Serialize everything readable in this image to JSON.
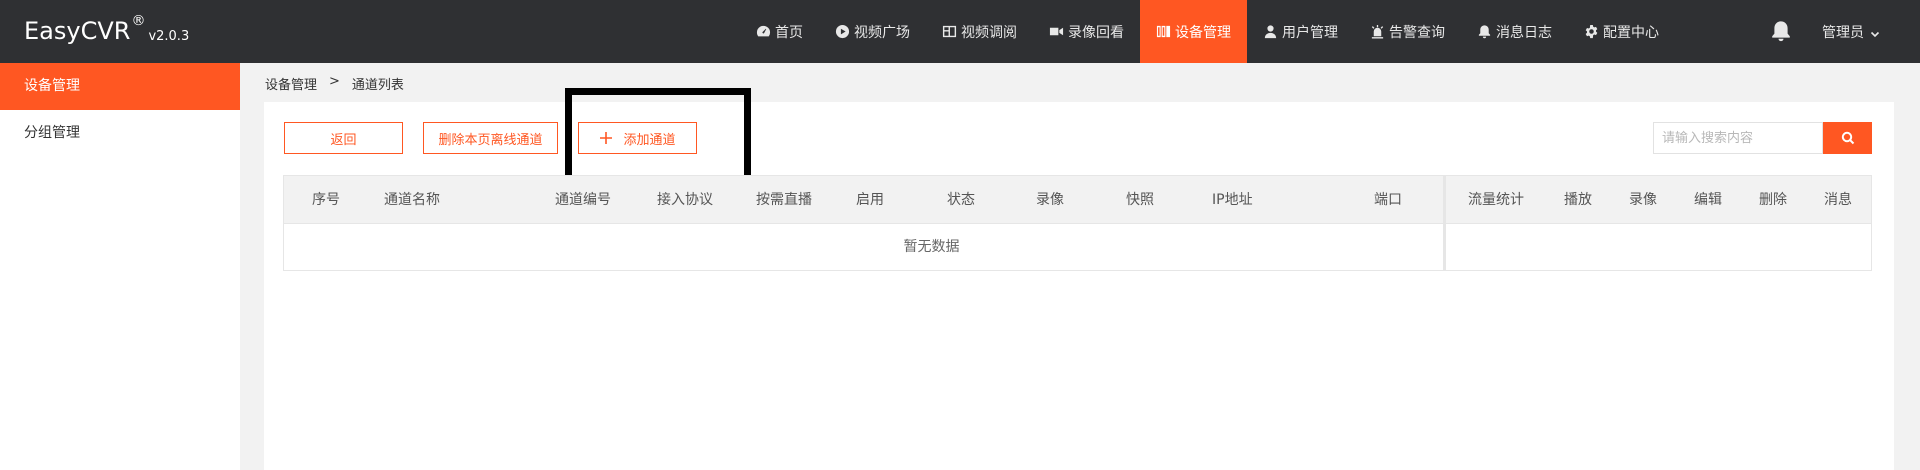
{
  "header": {
    "brand": "EasyCVR",
    "brand_reg": "®",
    "version": "v2.0.3",
    "nav": [
      {
        "label": "首页",
        "icon": "dashboard-icon",
        "active": false
      },
      {
        "label": "视频广场",
        "icon": "play-circle-icon",
        "active": false
      },
      {
        "label": "视频调阅",
        "icon": "grid-layout-icon",
        "active": false
      },
      {
        "label": "录像回看",
        "icon": "video-camera-icon",
        "active": false
      },
      {
        "label": "设备管理",
        "icon": "device-book-icon",
        "active": true
      },
      {
        "label": "用户管理",
        "icon": "user-icon",
        "active": false
      },
      {
        "label": "告警查询",
        "icon": "alarm-light-icon",
        "active": false
      },
      {
        "label": "消息日志",
        "icon": "bell-small-icon",
        "active": false
      },
      {
        "label": "配置中心",
        "icon": "gear-icon",
        "active": false
      }
    ],
    "user_label": "管理员"
  },
  "sidebar": {
    "items": [
      {
        "label": "设备管理",
        "active": true
      },
      {
        "label": "分组管理",
        "active": false
      }
    ]
  },
  "breadcrumb": {
    "parent": "设备管理",
    "separator": ">",
    "current": "通道列表"
  },
  "toolbar": {
    "back_label": "返回",
    "delete_offline_label": "删除本页离线通道",
    "add_channel_label": "添加通道"
  },
  "search": {
    "placeholder": "请输入搜索内容"
  },
  "table": {
    "columns_left": [
      "序号",
      "通道名称",
      "通道编号",
      "接入协议",
      "按需直播",
      "启用",
      "状态",
      "录像",
      "快照",
      "IP地址",
      "端口"
    ],
    "columns_right": [
      "流量统计",
      "播放",
      "录像",
      "编辑",
      "删除",
      "消息"
    ],
    "empty_text": "暂无数据"
  },
  "colors": {
    "accent": "#ff5722",
    "header_bg": "#2f3033"
  }
}
